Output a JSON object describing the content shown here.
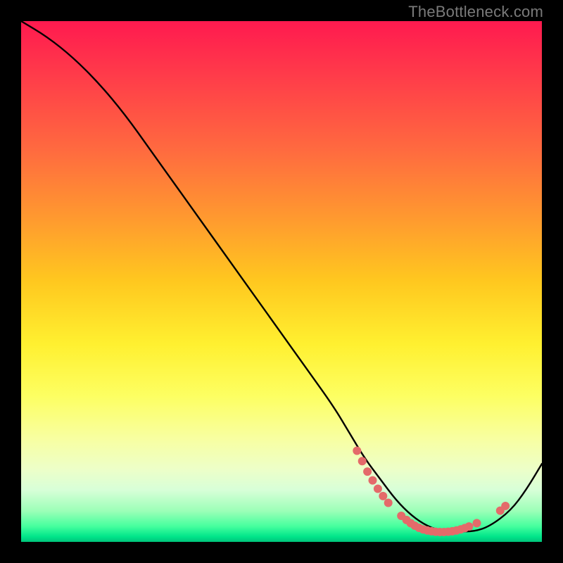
{
  "watermark": {
    "text": "TheBottleneck.com"
  },
  "chart_data": {
    "type": "line",
    "title": "",
    "xlabel": "",
    "ylabel": "",
    "xlim": [
      0,
      100
    ],
    "ylim": [
      0,
      100
    ],
    "grid": false,
    "legend": false,
    "series": [
      {
        "name": "curve",
        "x": [
          0,
          5,
          10,
          15,
          20,
          25,
          30,
          35,
          40,
          45,
          50,
          55,
          60,
          63,
          66,
          69,
          72,
          75,
          78,
          81,
          84,
          87,
          90,
          94,
          97,
          100
        ],
        "y": [
          100,
          97,
          93,
          88,
          82,
          75,
          68,
          61,
          54,
          47,
          40,
          33,
          26,
          21,
          16,
          12,
          8,
          5,
          3,
          2,
          2,
          2,
          3,
          6,
          10,
          15
        ],
        "color": "#000000"
      }
    ],
    "markers": [
      {
        "x": 64.5,
        "y": 17.5
      },
      {
        "x": 65.5,
        "y": 15.5
      },
      {
        "x": 66.5,
        "y": 13.5
      },
      {
        "x": 67.5,
        "y": 11.8
      },
      {
        "x": 68.5,
        "y": 10.2
      },
      {
        "x": 69.5,
        "y": 8.8
      },
      {
        "x": 70.5,
        "y": 7.5
      },
      {
        "x": 73.0,
        "y": 5.0
      },
      {
        "x": 74.0,
        "y": 4.2
      },
      {
        "x": 74.8,
        "y": 3.6
      },
      {
        "x": 75.6,
        "y": 3.1
      },
      {
        "x": 76.4,
        "y": 2.7
      },
      {
        "x": 77.2,
        "y": 2.4
      },
      {
        "x": 78.0,
        "y": 2.2
      },
      {
        "x": 78.8,
        "y": 2.05
      },
      {
        "x": 79.6,
        "y": 1.95
      },
      {
        "x": 80.4,
        "y": 1.9
      },
      {
        "x": 81.2,
        "y": 1.9
      },
      {
        "x": 82.0,
        "y": 1.95
      },
      {
        "x": 82.8,
        "y": 2.05
      },
      {
        "x": 83.6,
        "y": 2.2
      },
      {
        "x": 84.4,
        "y": 2.4
      },
      {
        "x": 85.2,
        "y": 2.65
      },
      {
        "x": 86.0,
        "y": 2.95
      },
      {
        "x": 87.5,
        "y": 3.6
      },
      {
        "x": 92.0,
        "y": 6.0
      },
      {
        "x": 93.0,
        "y": 6.9
      }
    ],
    "marker_style": {
      "color": "#e46a6a",
      "radius_px": 6
    },
    "background_gradient": {
      "direction": "vertical",
      "stops": [
        {
          "pos": 0.0,
          "color": "#ff1a4f"
        },
        {
          "pos": 0.25,
          "color": "#ff6b3f"
        },
        {
          "pos": 0.5,
          "color": "#ffc81f"
        },
        {
          "pos": 0.72,
          "color": "#fdff62"
        },
        {
          "pos": 0.9,
          "color": "#d8ffd8"
        },
        {
          "pos": 1.0,
          "color": "#00c47a"
        }
      ]
    }
  }
}
